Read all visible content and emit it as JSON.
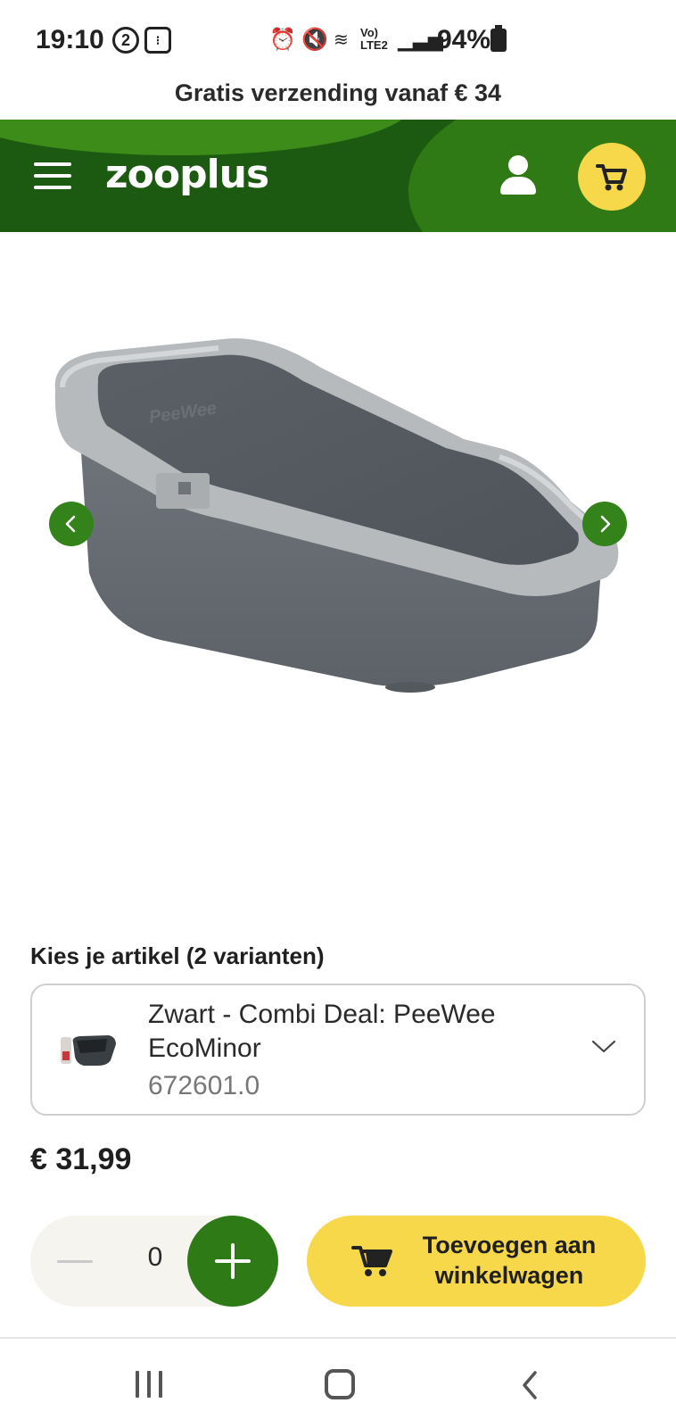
{
  "status_bar": {
    "time": "19:10",
    "notification_count": "2",
    "battery": "94%"
  },
  "promo": {
    "text": "Gratis verzending vanaf € 34"
  },
  "header": {
    "logo": "zooplus",
    "brand_color": "#1c5a12",
    "accent_color": "#f6d84a"
  },
  "gallery": {
    "product_image_brand": "PeeWee"
  },
  "variants": {
    "heading": "Kies je artikel (2 varianten)",
    "selected": {
      "name": "Zwart - Combi Deal: PeeWee EcoMinor",
      "sku": "672601.0"
    }
  },
  "price": "€ 31,99",
  "quantity": {
    "value": "0"
  },
  "add_to_cart": {
    "label": "Toevoegen aan winkelwagen"
  }
}
